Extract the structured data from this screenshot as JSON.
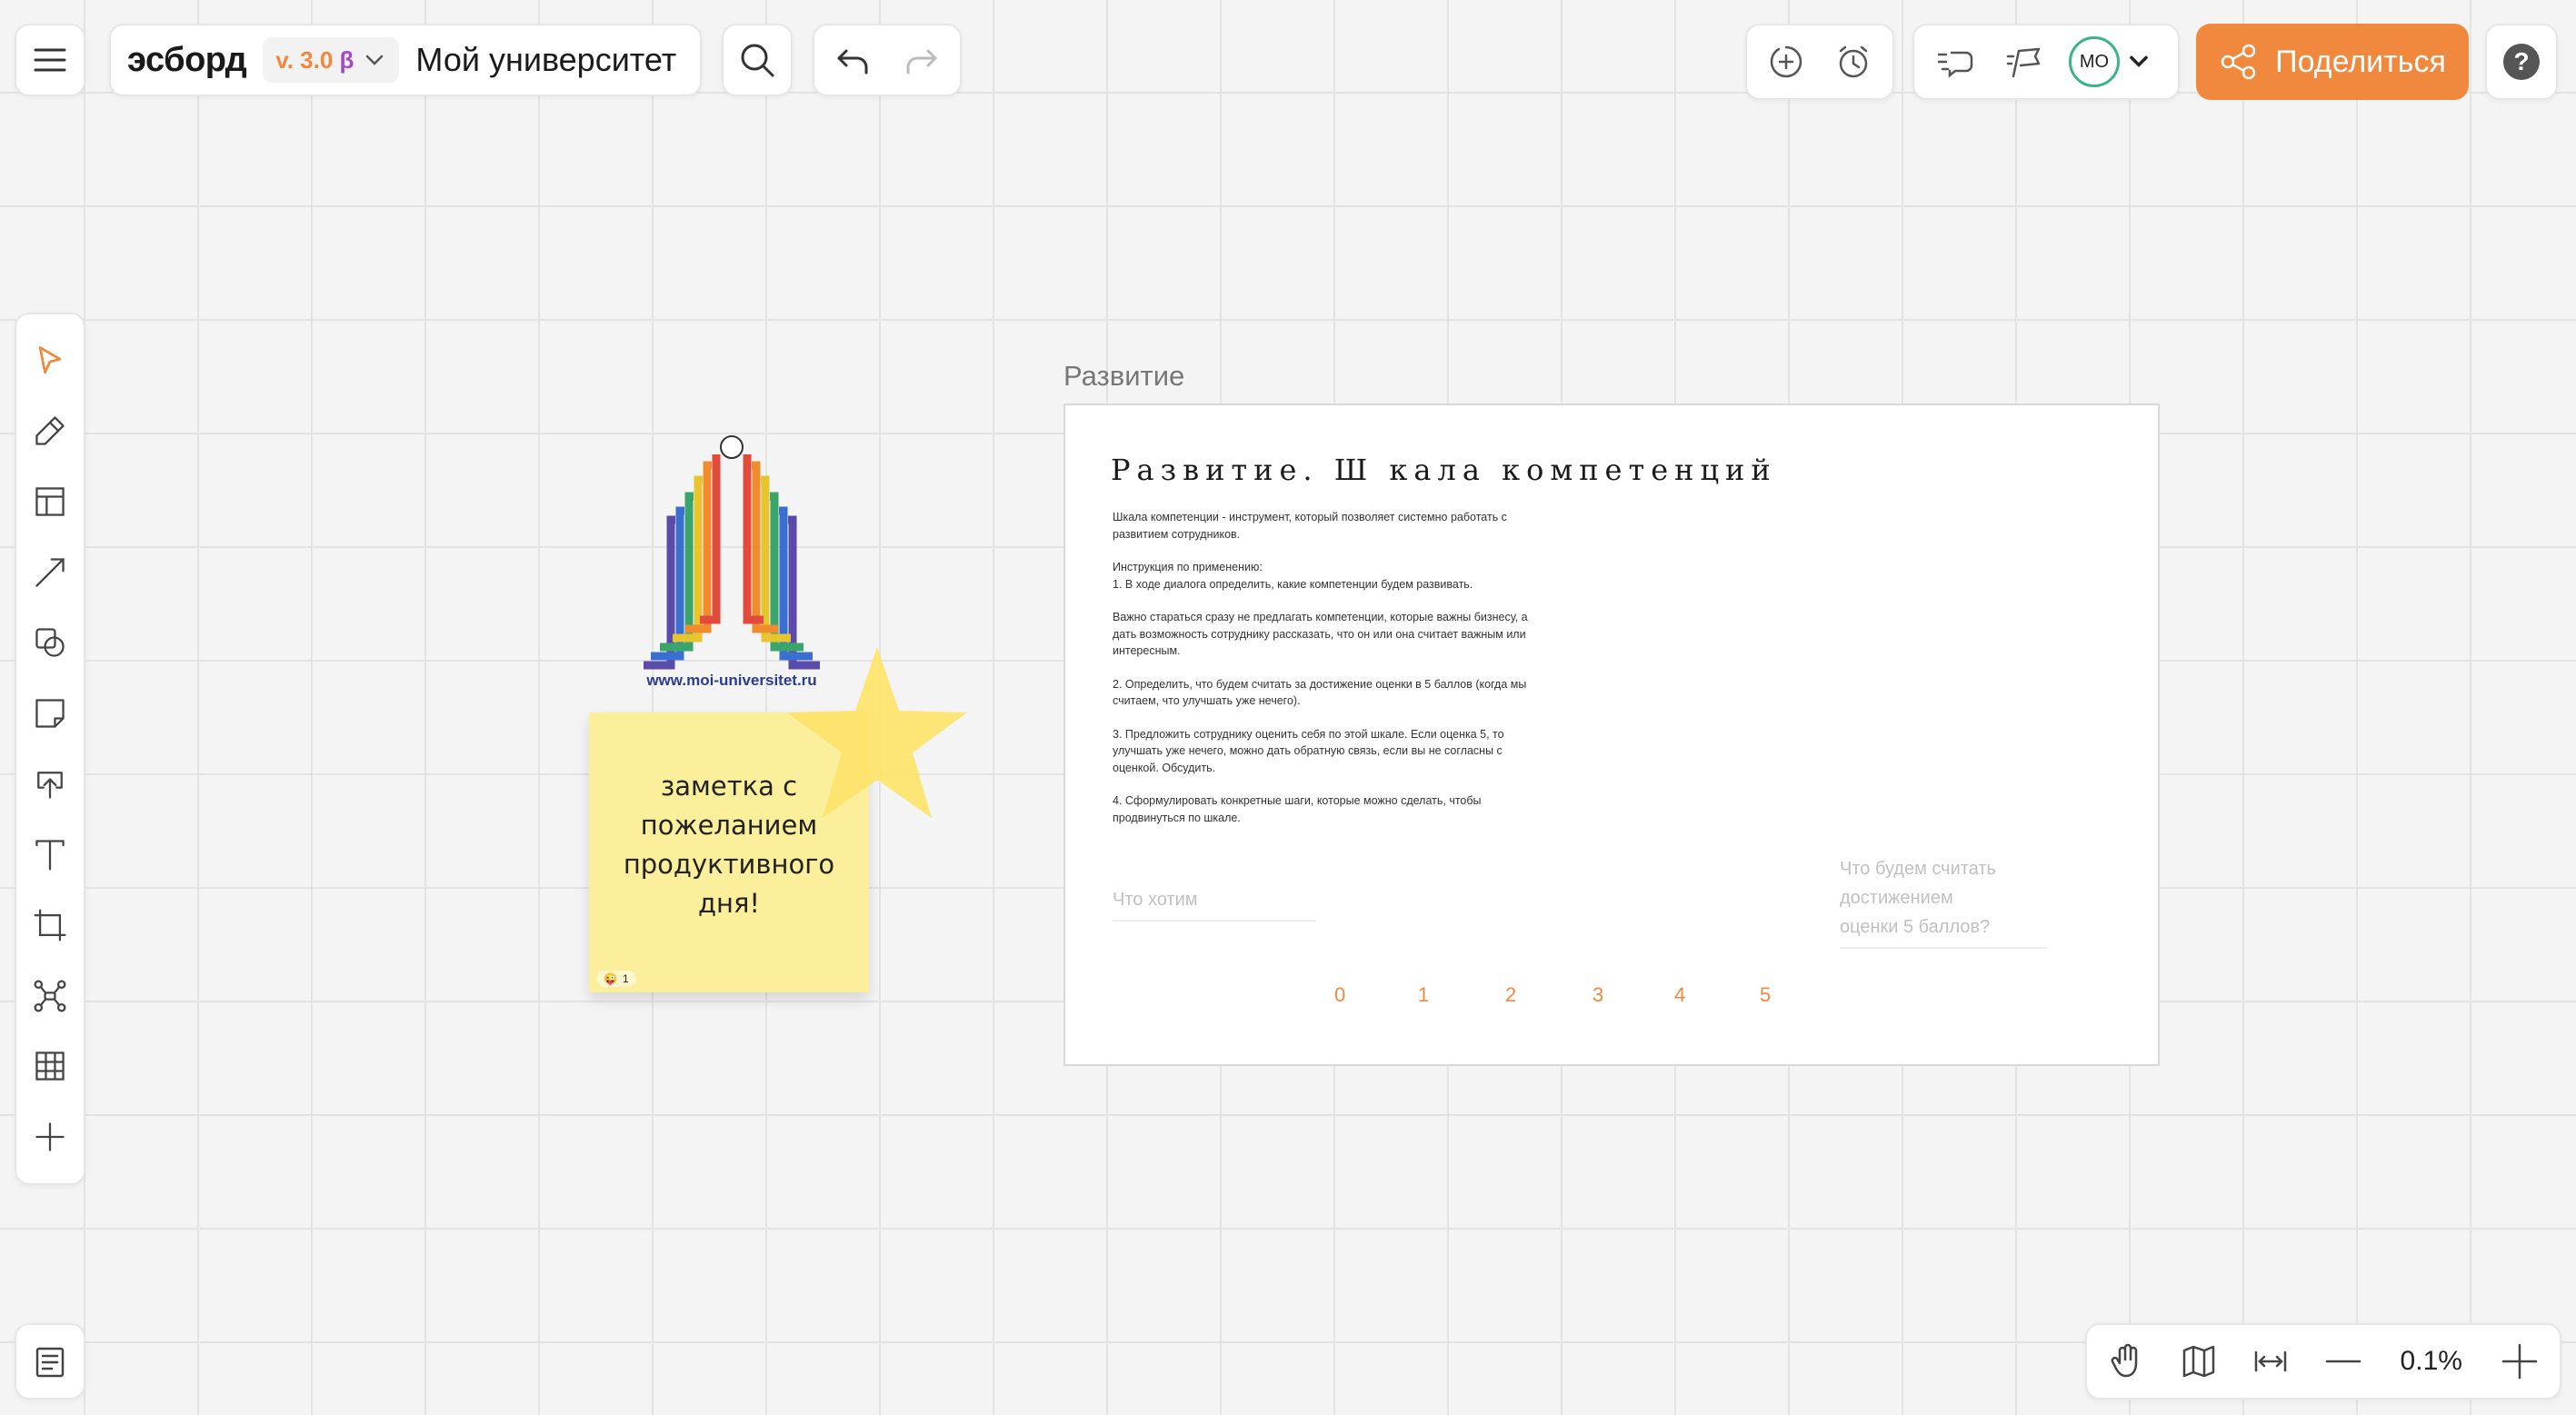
{
  "header": {
    "brand": "эсборд",
    "version": "v. 3.0",
    "beta": "β",
    "board_name": "Мой университет",
    "share_label": "Поделиться",
    "avatar_initials": "МО",
    "help": "?"
  },
  "frame": {
    "title": "Развитие",
    "heading": "Развитие. Ш кала компетенций",
    "body": [
      "Шкала компетенции - инструмент, который позволяет системно работать с\nразвитием сотрудников.",
      "Инструкция по применению:\n1. В ходе диалога определить, какие компетенции будем развивать.",
      "Важно стараться сразу не предлагать компетенции, которые важны бизнесу, а\nдать возможность сотруднику рассказать, что он или она считает важным или\nинтересным.",
      "2. Определить, что будем считать за достижение оценки в 5 баллов (когда мы\nсчитаем, что улучшать уже нечего).",
      "3. Предложить сотруднику оценить себя по этой шкале. Если оценка 5, то\nулучшать уже нечего, можно дать обратную связь, если вы не согласны с\nоценкой. Обсудить.",
      "4. Сформулировать конкретные шаги, которые можно сделать, чтобы\nпродвинуться по шкале."
    ],
    "field_want": "Что хотим",
    "field_score": "Что будем считать достижением\nоценки 5 баллов?",
    "scale": [
      "0",
      "1",
      "2",
      "3",
      "4",
      "5"
    ]
  },
  "logo": {
    "url_text": "www.moi-universitet.ru"
  },
  "sticky": {
    "text": "заметка с пожеланием продуктивного дня!",
    "reaction_emoji": "😜",
    "reaction_count": "1"
  },
  "zoom": {
    "value": "0.1%"
  },
  "colors": {
    "accent": "#f0883e",
    "beta": "#a845c9",
    "avatar_ring": "#3bb38a",
    "sticky": "#fcef9c",
    "star": "#fde36a"
  },
  "icons": {
    "toolbar": [
      "cursor-icon",
      "pen-icon",
      "template-icon",
      "arrow-icon",
      "shapes-icon",
      "sticky-note-icon",
      "upload-icon",
      "text-icon",
      "frame-icon",
      "mindmap-icon",
      "table-icon",
      "plus-icon"
    ]
  }
}
